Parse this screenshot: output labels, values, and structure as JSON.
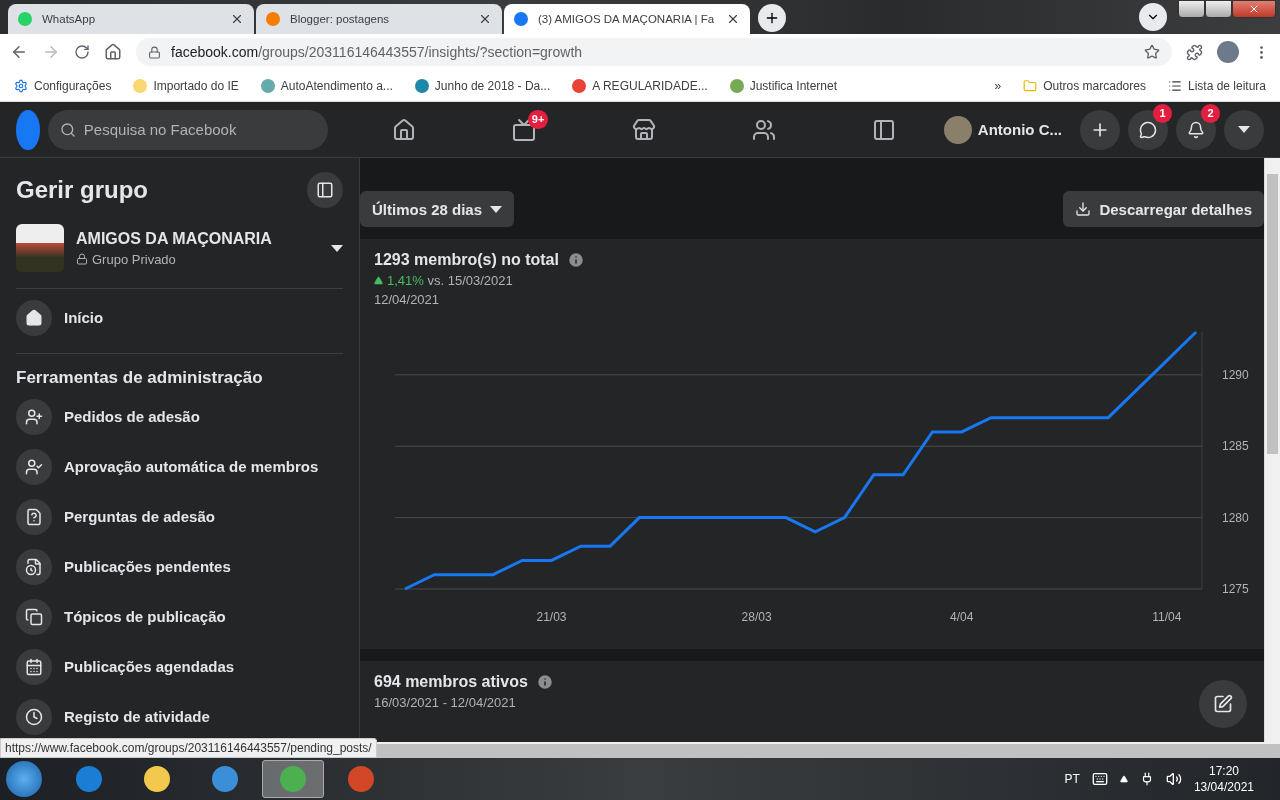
{
  "browser": {
    "tabs": [
      {
        "title": "WhatsApp",
        "selected": false
      },
      {
        "title": "Blogger: postagens",
        "selected": false
      },
      {
        "title": "(3) AMIGOS DA MAÇONARIA | Fa",
        "selected": true
      }
    ],
    "url": {
      "domain": "facebook.com",
      "path": "/groups/203116146443557/insights/?section=growth"
    },
    "bookmarks": [
      "Configurações",
      "Importado do IE",
      "AutoAtendimento a...",
      "Junho de 2018 - Da...",
      "A REGULARIDADE...",
      "Justifica Internet"
    ],
    "more": "»",
    "other_bookmarks": "Outros marcadores",
    "reading_list": "Lista de leitura"
  },
  "header": {
    "search_placeholder": "Pesquisa no Facebook",
    "video_badge": "9+",
    "profile_name": "Antonio C...",
    "messenger_badge": "1",
    "notifications_badge": "2"
  },
  "sidebar": {
    "title": "Gerir grupo",
    "group_name": "AMIGOS DA MAÇONARIA",
    "privacy": "Grupo Privado",
    "home": "Início",
    "section_title": "Ferramentas de administração",
    "items": [
      "Pedidos de adesão",
      "Aprovação automática de membros",
      "Perguntas de adesão",
      "Publicações pendentes",
      "Tópicos de publicação",
      "Publicações agendadas",
      "Registo de atividade"
    ]
  },
  "main": {
    "range": "Últimos 28 dias",
    "download": "Descarregar detalhes",
    "total_card": {
      "title": "1293 membro(s) no total",
      "change": "1,41%",
      "versus": "vs. 15/03/2021",
      "date": "12/04/2021",
      "chart_data": {
        "type": "line",
        "categories": [
          null,
          null,
          null,
          null,
          null,
          "21/03",
          null,
          null,
          null,
          null,
          null,
          null,
          "28/03",
          null,
          null,
          null,
          null,
          null,
          null,
          "4/04",
          null,
          null,
          null,
          null,
          null,
          null,
          "11/04",
          null
        ],
        "series": [
          {
            "color": "#1877f2",
            "values": [
              1275,
              1276,
              1276,
              1276,
              1277,
              1277,
              1278,
              1278,
              1280,
              1280,
              1280,
              1280,
              1280,
              1280,
              1279,
              1280,
              1283,
              1283,
              1286,
              1286,
              1287,
              1287,
              1287,
              1287,
              1287,
              1289,
              1291,
              1293
            ]
          }
        ],
        "ylim": [
          1275,
          1293
        ],
        "yticks": [
          1275,
          1280,
          1285,
          1290
        ],
        "grid": true
      }
    },
    "active_card": {
      "title": "694 membros ativos",
      "dates": "16/03/2021 - 12/04/2021"
    }
  },
  "status_link": "https://www.facebook.com/groups/203116146443557/pending_posts/",
  "taskbar": {
    "apps": [
      {
        "selected": false
      },
      {
        "selected": false
      },
      {
        "selected": false
      },
      {
        "selected": true
      },
      {
        "selected": false
      }
    ],
    "language": "PT",
    "time": "17:20",
    "date": "13/04/2021"
  }
}
